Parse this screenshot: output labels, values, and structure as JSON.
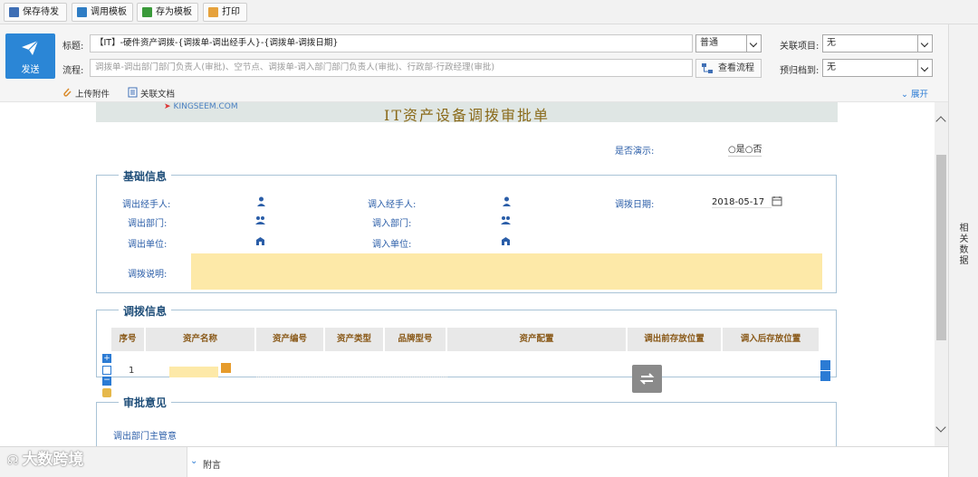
{
  "toolbar": {
    "save_draft": "保存待发",
    "use_template": "调用模板",
    "save_as_template": "存为模板",
    "print": "打印"
  },
  "header": {
    "send_label": "发送",
    "title_label": "标题:",
    "title_value": "【IT】-硬件资产调拨-{调拨单-调出经手人}-{调拨单-调拨日期}",
    "priority_value": "普通",
    "related_project_label": "关联项目:",
    "related_project_value": "无",
    "flow_label": "流程:",
    "flow_value": "调拨单-调出部门部门负责人(审批)、空节点、调拨单-调入部门部门负责人(审批)、行政部-行政经理(审批)",
    "view_flow": "查看流程",
    "archive_label": "预归档到:",
    "archive_value": "无",
    "upload_attachment": "上传附件",
    "related_doc": "关联文档",
    "expand": "展开"
  },
  "right_panel": {
    "label": "相关数据"
  },
  "form": {
    "logo_text": "KINGSEEM.COM",
    "title": "IT资产设备调拨审批单",
    "demo_label": "是否演示:",
    "demo_options": "○是○否",
    "basic_section": "基础信息",
    "out_handler_label": "调出经手人:",
    "in_handler_label": "调入经手人:",
    "transfer_date_label": "调拨日期:",
    "transfer_date_value": "2018-05-17",
    "out_dept_label": "调出部门:",
    "in_dept_label": "调入部门:",
    "out_unit_label": "调出单位:",
    "in_unit_label": "调入单位:",
    "transfer_note_label": "调拨说明:",
    "transfer_section": "调拨信息",
    "table_headers": [
      "序号",
      "资产名称",
      "资产编号",
      "资产类型",
      "品牌型号",
      "资产配置",
      "调出前存放位置",
      "调入后存放位置"
    ],
    "row_index": "1",
    "approval_section": "审批意见",
    "out_dept_opinion_label": "调出部门主管意"
  },
  "bottom": {
    "remark": "附言"
  },
  "watermark": "大数跨境",
  "colors": {
    "accent": "#2b86d6",
    "field_fill": "#fde9a8",
    "section_title": "#1f4e79",
    "label_blue": "#2b5ea8"
  }
}
